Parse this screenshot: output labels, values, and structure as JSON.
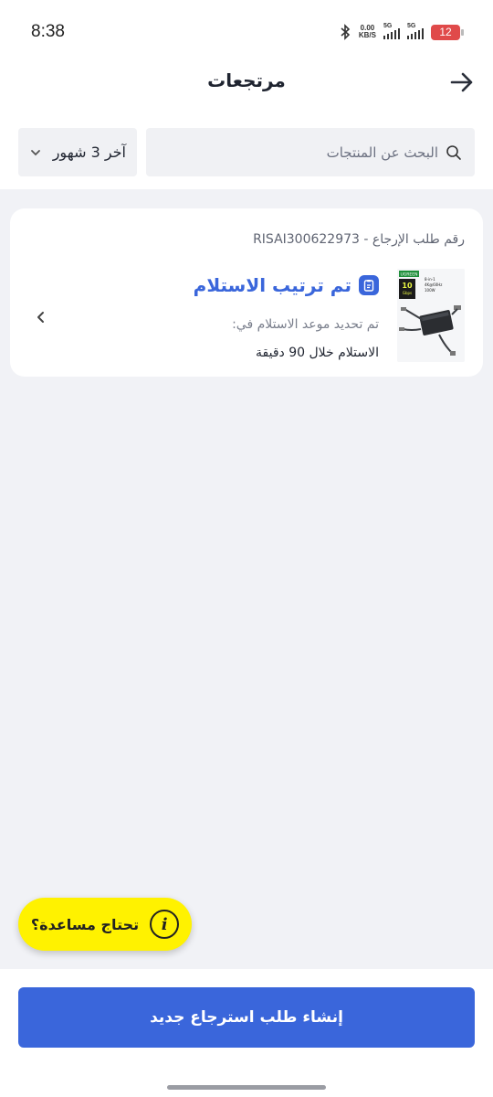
{
  "status_bar": {
    "time": "8:38",
    "net_speed_value": "0.00",
    "net_speed_unit": "KB/S",
    "signal_1_label": "5G",
    "signal_2_label": "5G",
    "battery_level": "12"
  },
  "header": {
    "title": "مرتجعات"
  },
  "filters": {
    "search_placeholder": "البحث عن المنتجات",
    "period_label": "آخر 3 شهور"
  },
  "return_card": {
    "request_id_text": "رقم طلب الإرجاع - RISAI300622973",
    "status_title": "تم ترتيب الاستلام",
    "status_subtitle": "تم تحديد موعد الاستلام في:",
    "status_detail": "الاستلام خلال 90 دقيقة",
    "product_image": {
      "brand": "UGREEN",
      "badge_main": "10",
      "badge_sub": "Gbps",
      "spec_1": "8-in-1",
      "spec_2": "4K@60Hz",
      "spec_3": "100W"
    }
  },
  "help": {
    "label": "تحتاج مساعدة؟"
  },
  "primary_action": {
    "label": "إنشاء طلب استرجاع جديد"
  },
  "colors": {
    "accent": "#3a66db",
    "help_yellow": "#fff200",
    "background": "#f1f2f6",
    "battery_low": "#e04a4a"
  },
  "icons": [
    "bluetooth-icon",
    "signal-icon",
    "battery-icon",
    "back-arrow-icon",
    "search-icon",
    "chevron-down-icon",
    "clipboard-icon",
    "chevron-left-icon",
    "info-icon"
  ]
}
